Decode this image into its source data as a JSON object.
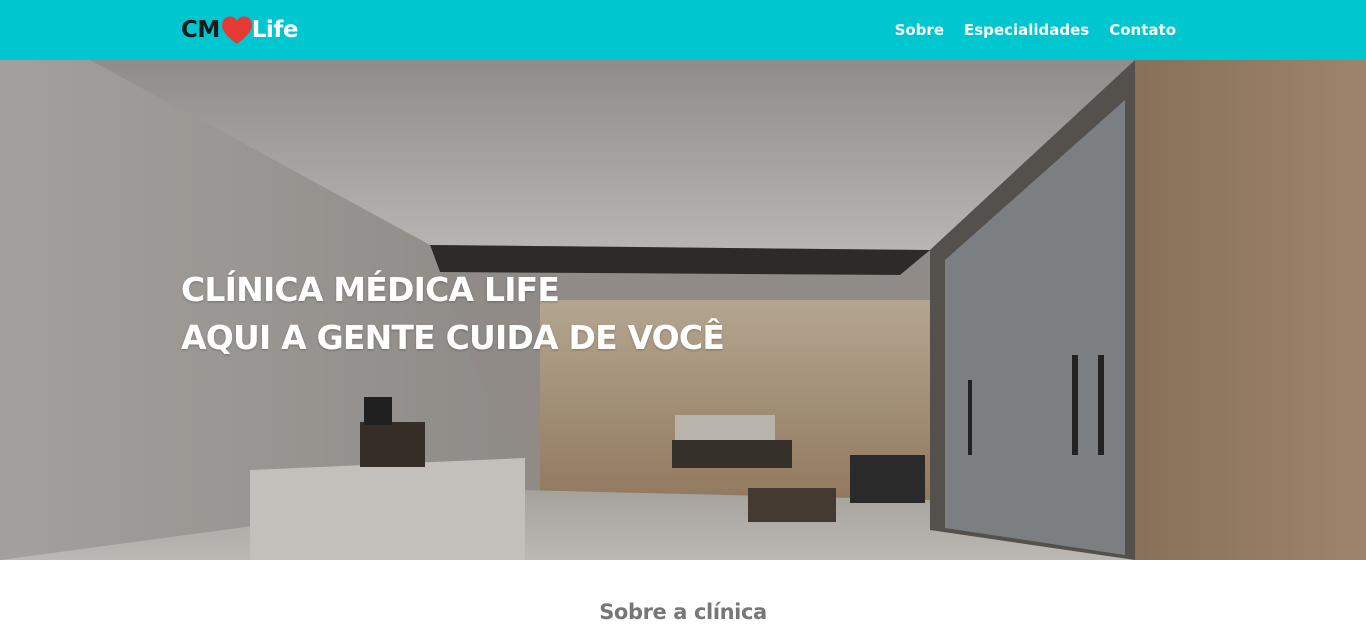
{
  "brand": {
    "prefix": "CM",
    "suffix": "Life",
    "heart_color": "#e53935"
  },
  "nav": {
    "items": [
      {
        "label": "Sobre"
      },
      {
        "label": "Especialidades"
      },
      {
        "label": "Contato"
      }
    ]
  },
  "hero": {
    "line1": "CLÍNICA MÉDICA LIFE",
    "line2": "AQUI A GENTE CUIDA DE VOCÊ"
  },
  "about": {
    "title": "Sobre a clínica"
  },
  "colors": {
    "navbar": "#00c6cf",
    "text_light": "#ffffff",
    "heading_gray": "#777777"
  }
}
